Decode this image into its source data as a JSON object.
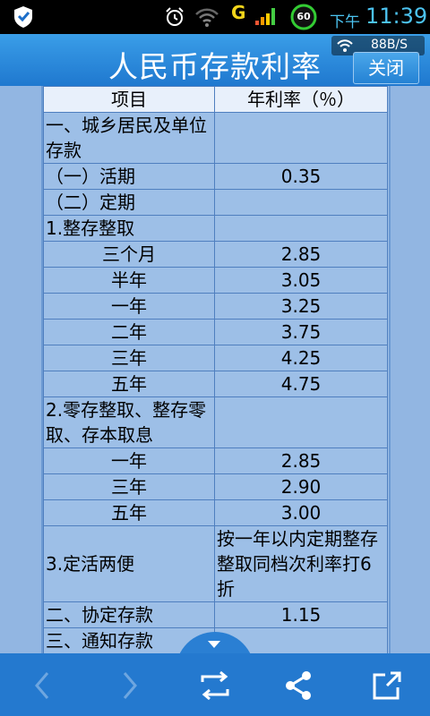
{
  "status_bar": {
    "network_type": "G",
    "battery_level": "60",
    "time_prefix": "下午",
    "time": "11:39",
    "icons": [
      "shield-icon",
      "alarm-icon",
      "wifi-icon",
      "signal-icon",
      "battery-icon"
    ]
  },
  "header": {
    "title": "人民币存款利率",
    "close_label": "关闭",
    "speed": "88B/S"
  },
  "table": {
    "headers": [
      "项目",
      "年利率（％）"
    ],
    "rows": [
      {
        "item": "一、城乡居民及单位存款",
        "rate": ""
      },
      {
        "item": "（一）活期",
        "rate": "0.35"
      },
      {
        "item": "（二）定期",
        "rate": ""
      },
      {
        "item": "1.整存整取",
        "rate": ""
      },
      {
        "item": "三个月",
        "rate": "2.85"
      },
      {
        "item": "半年",
        "rate": "3.05"
      },
      {
        "item": "一年",
        "rate": "3.25"
      },
      {
        "item": "二年",
        "rate": "3.75"
      },
      {
        "item": "三年",
        "rate": "4.25"
      },
      {
        "item": "五年",
        "rate": "4.75"
      },
      {
        "item": "2.零存整取、整存零取、存本取息",
        "rate": ""
      },
      {
        "item": "一年",
        "rate": "2.85"
      },
      {
        "item": "三年",
        "rate": "2.90"
      },
      {
        "item": "五年",
        "rate": "3.00"
      },
      {
        "item": "3.定活两便",
        "rate": "按一年以内定期整存整取同档次利率打6折"
      },
      {
        "item": "二、协定存款",
        "rate": "1.15"
      },
      {
        "item": "三、通知存款",
        "rate": ""
      }
    ]
  },
  "bottom_bar": {
    "items": [
      "back-icon",
      "forward-icon",
      "refresh-icon",
      "share-icon",
      "open-external-icon"
    ]
  },
  "colors": {
    "accent": "#2479cf",
    "content_bg": "#9dbfe7",
    "header_bg": "#e8f0fb"
  }
}
